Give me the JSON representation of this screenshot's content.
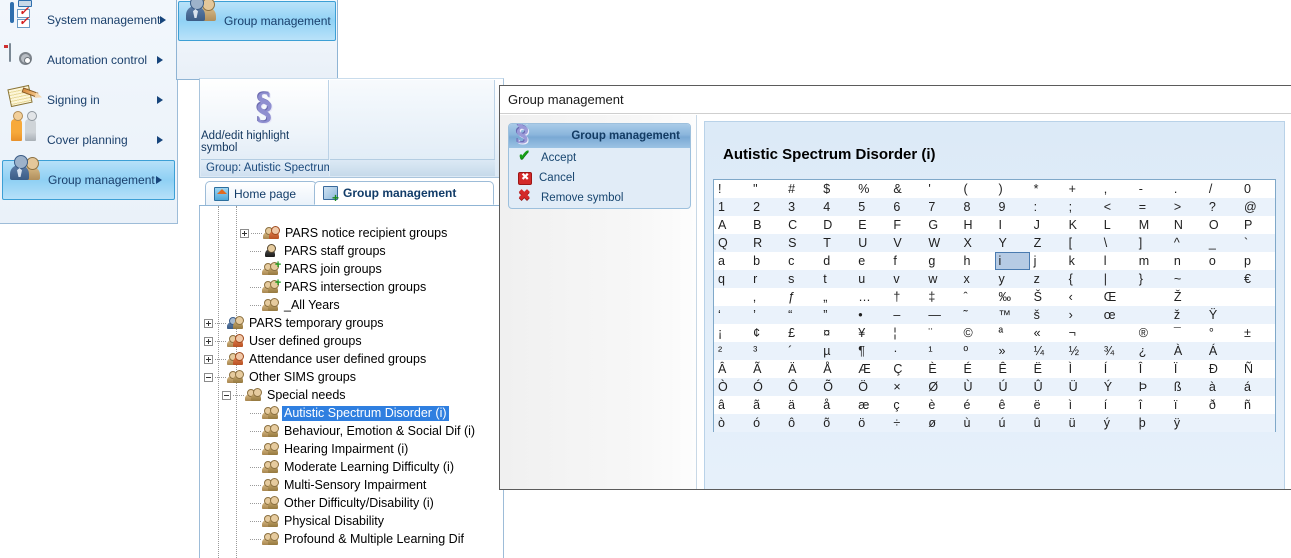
{
  "nav": {
    "items": [
      {
        "label": "System management",
        "icon": "clipboard-check-icon",
        "has_submenu": true,
        "selected": false
      },
      {
        "label": "Automation control",
        "icon": "gear-window-icon",
        "has_submenu": true,
        "selected": false
      },
      {
        "label": "Signing in",
        "icon": "pen-paper-icon",
        "has_submenu": true,
        "selected": false
      },
      {
        "label": "Cover planning",
        "icon": "two-people-icon",
        "has_submenu": true,
        "selected": false
      },
      {
        "label": "Group management",
        "icon": "group-users-icon",
        "has_submenu": true,
        "selected": true
      }
    ]
  },
  "flyout": {
    "items": [
      {
        "label": "Group management",
        "icon": "group-users-icon",
        "selected": true
      }
    ]
  },
  "ribbon": {
    "button_symbol": "§",
    "button_label": "Add/edit highlight symbol",
    "status_label": "Group: Autistic Spectrum"
  },
  "tabs": [
    {
      "label": "Home page",
      "icon": "home-icon",
      "active": false
    },
    {
      "label": "Group management",
      "icon": "group-management-icon",
      "active": true
    }
  ],
  "tree": {
    "nodes": [
      {
        "label": "PARS notice recipient groups",
        "indent": 3,
        "expander": "plus",
        "icon": "group-red-icon",
        "selected": false
      },
      {
        "label": "PARS staff groups",
        "indent": 3,
        "expander": "none",
        "icon": "person-dark-icon",
        "selected": false
      },
      {
        "label": "PARS join groups",
        "indent": 3,
        "expander": "none",
        "icon": "group-plus-icon",
        "selected": false
      },
      {
        "label": "PARS intersection groups",
        "indent": 3,
        "expander": "none",
        "icon": "group-plus-icon",
        "selected": false
      },
      {
        "label": "_All Years",
        "indent": 3,
        "expander": "none",
        "icon": "group-icon",
        "selected": false
      },
      {
        "label": "PARS temporary groups",
        "indent": 1,
        "expander": "plus",
        "icon": "group-dark-icon",
        "selected": false
      },
      {
        "label": "User defined groups",
        "indent": 1,
        "expander": "plus",
        "icon": "group-red-icon",
        "selected": false
      },
      {
        "label": "Attendance user defined groups",
        "indent": 1,
        "expander": "plus",
        "icon": "group-red-icon",
        "selected": false
      },
      {
        "label": "Other SIMS groups",
        "indent": 1,
        "expander": "minus",
        "icon": "group-icon",
        "selected": false
      },
      {
        "label": "Special needs",
        "indent": 2,
        "expander": "minus",
        "icon": "group-icon",
        "selected": false
      },
      {
        "label": "Autistic Spectrum Disorder (i)",
        "indent": 3,
        "expander": "none",
        "icon": "group-icon",
        "selected": true
      },
      {
        "label": "Behaviour, Emotion & Social Dif (i)",
        "indent": 3,
        "expander": "none",
        "icon": "group-icon",
        "selected": false
      },
      {
        "label": "Hearing Impairment (i)",
        "indent": 3,
        "expander": "none",
        "icon": "group-icon",
        "selected": false
      },
      {
        "label": "Moderate Learning Difficulty (i)",
        "indent": 3,
        "expander": "none",
        "icon": "group-icon",
        "selected": false
      },
      {
        "label": "Multi-Sensory Impairment",
        "indent": 3,
        "expander": "none",
        "icon": "group-icon",
        "selected": false
      },
      {
        "label": "Other Difficulty/Disability (i)",
        "indent": 3,
        "expander": "none",
        "icon": "group-icon",
        "selected": false
      },
      {
        "label": "Physical Disability",
        "indent": 3,
        "expander": "none",
        "icon": "group-icon",
        "selected": false
      },
      {
        "label": "Profound & Multiple Learning Dif",
        "indent": 3,
        "expander": "none",
        "icon": "group-icon",
        "selected": false
      }
    ]
  },
  "dialog": {
    "title": "Group management",
    "action_panel": {
      "symbol": "§",
      "header": "Group management",
      "actions": [
        {
          "label": "Accept",
          "icon": "green-check-icon"
        },
        {
          "label": "Cancel",
          "icon": "red-x-box-icon"
        },
        {
          "label": "Remove symbol",
          "icon": "red-x-icon"
        }
      ]
    },
    "char_pane": {
      "title": "Autistic Spectrum Disorder (i)",
      "selected_char": "i",
      "selected_row": 4,
      "selected_col": 8,
      "rows": [
        [
          "!",
          "\"",
          "#",
          "$",
          "%",
          "&",
          "'",
          "(",
          ")",
          "*",
          "+",
          ",",
          "-",
          ".",
          "/",
          "0"
        ],
        [
          "1",
          "2",
          "3",
          "4",
          "5",
          "6",
          "7",
          "8",
          "9",
          ":",
          ";",
          "<",
          "=",
          ">",
          "?",
          "@"
        ],
        [
          "A",
          "B",
          "C",
          "D",
          "E",
          "F",
          "G",
          "H",
          "I",
          "J",
          "K",
          "L",
          "M",
          "N",
          "O",
          "P"
        ],
        [
          "Q",
          "R",
          "S",
          "T",
          "U",
          "V",
          "W",
          "X",
          "Y",
          "Z",
          "[",
          "\\",
          "]",
          "^",
          "_",
          "`"
        ],
        [
          "a",
          "b",
          "c",
          "d",
          "e",
          "f",
          "g",
          "h",
          "i",
          "j",
          "k",
          "l",
          "m",
          "n",
          "o",
          "p"
        ],
        [
          "q",
          "r",
          "s",
          "t",
          "u",
          "v",
          "w",
          "x",
          "y",
          "z",
          "{",
          "|",
          "}",
          "~",
          "",
          "€"
        ],
        [
          "",
          "‚",
          "ƒ",
          "„",
          "…",
          "†",
          "‡",
          "ˆ",
          "‰",
          "Š",
          "‹",
          "Œ",
          "",
          "Ž",
          "",
          ""
        ],
        [
          "‘",
          "’",
          "“",
          "”",
          "•",
          "–",
          "—",
          "˜",
          "™",
          "š",
          "›",
          "œ",
          "",
          "ž",
          "Ÿ",
          ""
        ],
        [
          "¡",
          "¢",
          "£",
          "¤",
          "¥",
          "¦",
          "¨",
          "©",
          "ª",
          "«",
          "¬",
          "",
          "®",
          "¯",
          "°",
          "±"
        ],
        [
          "²",
          "³",
          "´",
          "µ",
          "¶",
          "·",
          "¹",
          "º",
          "»",
          "¼",
          "½",
          "¾",
          "¿",
          "À",
          "Á",
          ""
        ],
        [
          "Â",
          "Ã",
          "Ä",
          "Å",
          "Æ",
          "Ç",
          "È",
          "É",
          "Ê",
          "Ë",
          "Ì",
          "Í",
          "Î",
          "Ï",
          "Ð",
          "Ñ"
        ],
        [
          "Ò",
          "Ó",
          "Ô",
          "Õ",
          "Ö",
          "×",
          "Ø",
          "Ù",
          "Ú",
          "Û",
          "Ü",
          "Ý",
          "Þ",
          "ß",
          "à",
          "á"
        ],
        [
          "â",
          "ã",
          "ä",
          "å",
          "æ",
          "ç",
          "è",
          "é",
          "ê",
          "ë",
          "ì",
          "í",
          "î",
          "ï",
          "ð",
          "ñ"
        ],
        [
          "ò",
          "ó",
          "ô",
          "õ",
          "ö",
          "÷",
          "ø",
          "ù",
          "ú",
          "û",
          "ü",
          "ý",
          "þ",
          "ÿ",
          "",
          ""
        ]
      ]
    }
  },
  "colors": {
    "accent_blue": "#2f7fe0",
    "nav_selected": "#8fd0f4",
    "panel_blue": "#dceaf7",
    "cell_selected": "#b6cbe4",
    "grid_alt_row": "#eaf2fb"
  }
}
